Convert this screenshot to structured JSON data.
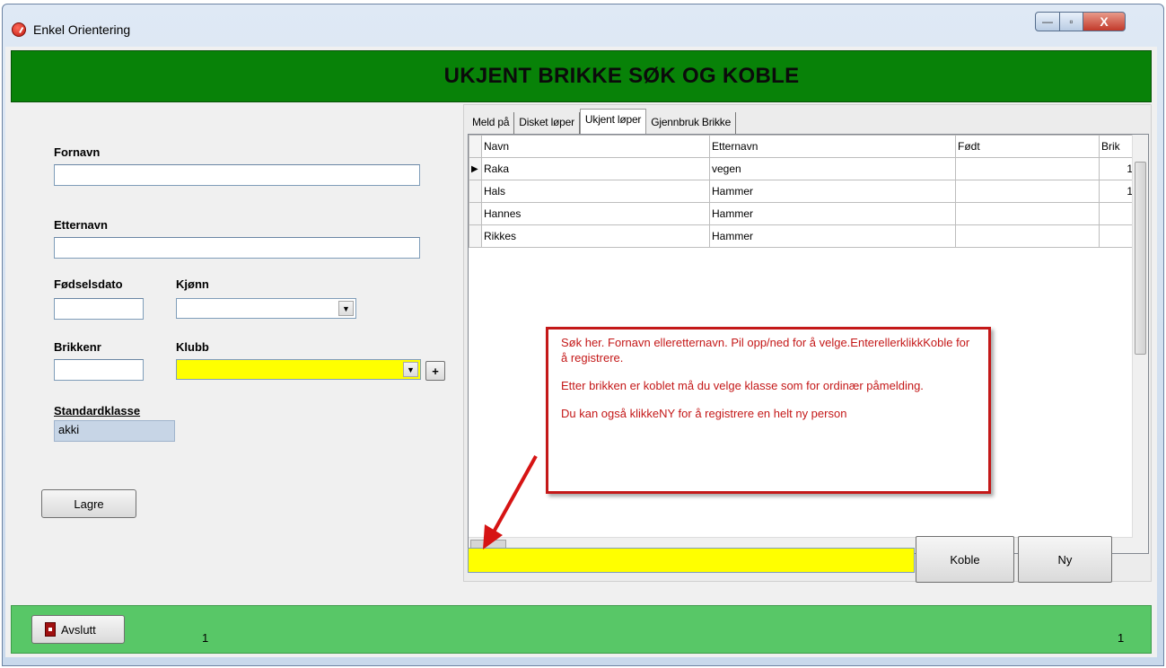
{
  "window": {
    "title": "Enkel Orientering",
    "minimize": "—",
    "maximize": "▫",
    "close": "X"
  },
  "header": {
    "title": "UKJENT BRIKKE SØK OG KOBLE"
  },
  "form": {
    "fornavn_label": "Fornavn",
    "fornavn_value": "",
    "etternavn_label": "Etternavn",
    "etternavn_value": "",
    "fodselsdato_label": "Fødselsdato",
    "kjonn_label": "Kjønn",
    "brikkenr_label": "Brikkenr",
    "klubb_label": "Klubb",
    "add_label": "+",
    "standardklasse_label": "Standardklasse",
    "standardklasse_value": "akki",
    "lagre_label": "Lagre"
  },
  "tabs": [
    {
      "label": "Meld på"
    },
    {
      "label": "Disket løper"
    },
    {
      "label": "Ukjent løper",
      "active": true
    },
    {
      "label": "Gjennbruk Brikke"
    }
  ],
  "grid": {
    "columns": [
      "Navn",
      "Etternavn",
      "Født",
      "Brik"
    ],
    "rows": [
      {
        "navn": "Raka",
        "etternavn": "vegen",
        "fodt": "",
        "brik": "1",
        "selected": true
      },
      {
        "navn": "Hals",
        "etternavn": "Hammer",
        "fodt": "",
        "brik": "1"
      },
      {
        "navn": "Hannes",
        "etternavn": "Hammer",
        "fodt": "",
        "brik": ""
      },
      {
        "navn": "Rikkes",
        "etternavn": "Hammer",
        "fodt": "",
        "brik": ""
      }
    ]
  },
  "search": {
    "value": ""
  },
  "actions": {
    "koble_label": "Koble",
    "ny_label": "Ny"
  },
  "note": {
    "p1": "Søk her. Fornavn elleretternavn. Pil opp/ned for å velge.EnterellerklikkKoble for å registrere.",
    "p2": "Etter brikken er koblet  må du velge klasse som for ordinær påmelding.",
    "p3": "Du kan også klikkeNY for å registrere en helt ny person"
  },
  "statusbar": {
    "avslutt_label": "Avslutt",
    "left_count": "1",
    "right_count": "1"
  },
  "colors": {
    "header_green": "#088208",
    "status_green": "#58c767",
    "highlight_yellow": "#ffff00",
    "note_red": "#c41818"
  }
}
